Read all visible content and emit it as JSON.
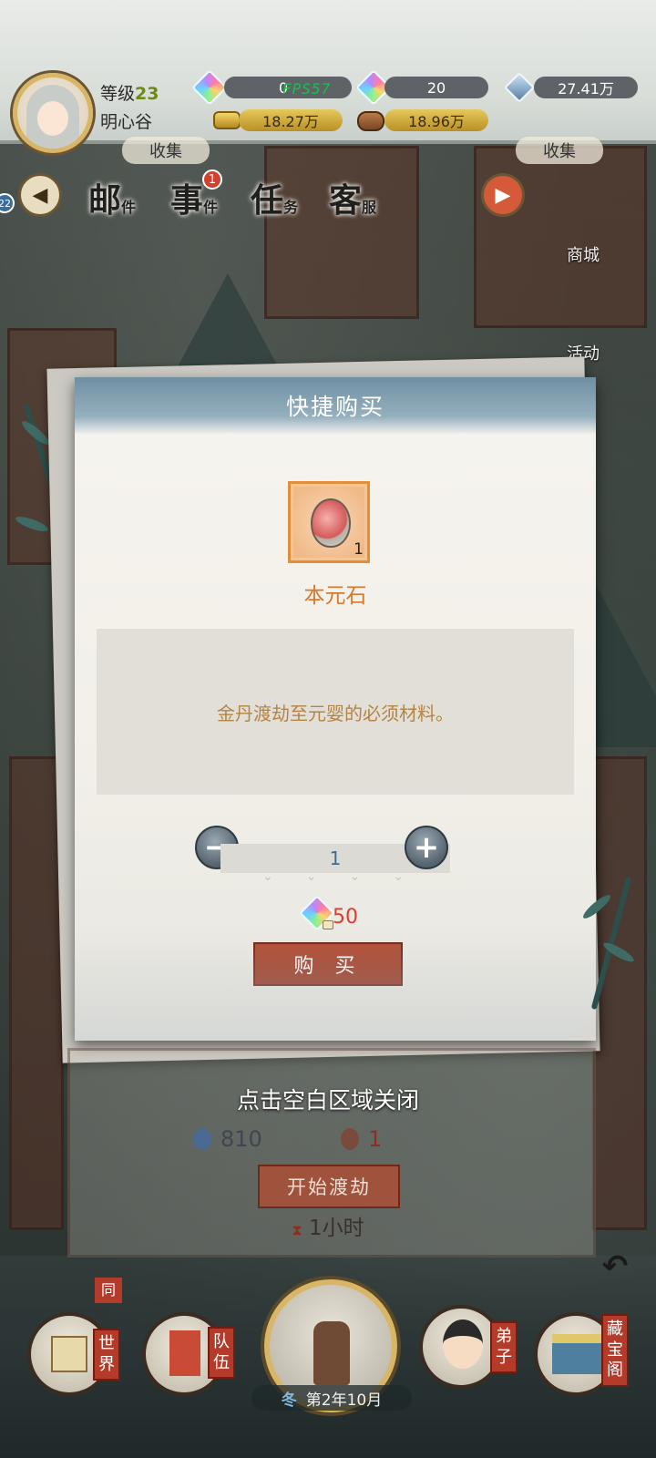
{
  "player": {
    "level_label": "等级",
    "level": "23",
    "location": "明心谷"
  },
  "resources": {
    "gem_free": "0",
    "fps_overlay": "FPS57",
    "gem_bound": "20",
    "crystal": "27.41万",
    "gold": "18.27万",
    "wood": "18.96万"
  },
  "menu": {
    "mail": {
      "main": "邮",
      "sub": "件"
    },
    "events": {
      "main": "事",
      "sub": "件",
      "badge": "1"
    },
    "tasks": {
      "main": "任",
      "sub": "务"
    },
    "service": {
      "main": "客",
      "sub": "服"
    },
    "collect_left": "收集",
    "collect_right": "收集",
    "shop": "商城",
    "activity": "活动",
    "left_badge": "22"
  },
  "modal": {
    "title": "快捷购买",
    "item_name": "本元石",
    "item_count": "1",
    "description": "金丹渡劫至元婴的必须材料。",
    "quantity": "1",
    "minus_symbol": "−",
    "plus_symbol": "+",
    "price": "50",
    "buy_label": "购 买"
  },
  "close_hint": "点击空白区域关闭",
  "tribulation": {
    "cost_crystal": "810",
    "cost_stone": "1",
    "start_label": "开始渡劫",
    "duration": "1小时"
  },
  "bottom_nav": {
    "tag_small": "同",
    "world": "世界",
    "team": "队伍",
    "disciple": "弟子",
    "treasure": "藏宝阁",
    "season": "冬",
    "date": "第2年10月"
  },
  "icons": {
    "gem": "rainbow-gem-icon",
    "crystal": "blue-crystal-icon",
    "gold": "gold-ingot-icon",
    "wood": "wood-log-icon",
    "stone": "origin-stone-icon"
  },
  "colors": {
    "accent_red": "#b24a31",
    "item_name_orange": "#d4792e",
    "description_gold": "#b48442",
    "price_red": "#e03b2f",
    "quantity_blue": "#3d6d95"
  }
}
